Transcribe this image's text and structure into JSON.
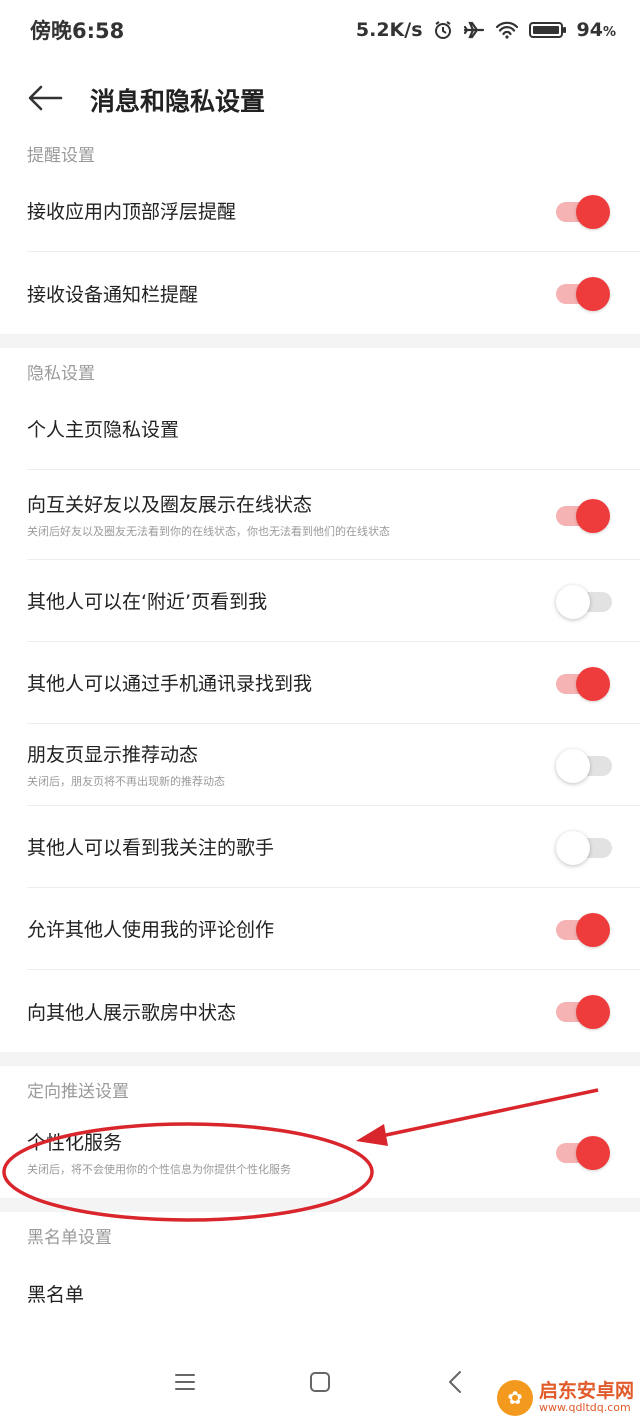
{
  "status_bar": {
    "time": "傍晚6:58",
    "network_speed": "5.2K/s",
    "battery": "94",
    "battery_unit": "%"
  },
  "header": {
    "title": "消息和隐私设置"
  },
  "sections": {
    "reminder": {
      "title": "提醒设置",
      "items": [
        {
          "label": "接收应用内顶部浮层提醒",
          "on": true
        },
        {
          "label": "接收设备通知栏提醒",
          "on": true
        }
      ]
    },
    "privacy": {
      "title": "隐私设置",
      "items": [
        {
          "label": "个人主页隐私设置"
        },
        {
          "label": "向互关好友以及圈友展示在线状态",
          "desc": "关闭后好友以及圈友无法看到你的在线状态，你也无法看到他们的在线状态",
          "on": true
        },
        {
          "label": "其他人可以在‘附近’页看到我",
          "on": false
        },
        {
          "label": "其他人可以通过手机通讯录找到我",
          "on": true
        },
        {
          "label": "朋友页显示推荐动态",
          "desc": "关闭后，朋友页将不再出现新的推荐动态",
          "on": false
        },
        {
          "label": "其他人可以看到我关注的歌手",
          "on": false
        },
        {
          "label": "允许其他人使用我的评论创作",
          "on": true
        },
        {
          "label": "向其他人展示歌房中状态",
          "on": true
        }
      ]
    },
    "targeted_push": {
      "title": "定向推送设置",
      "items": [
        {
          "label": "个性化服务",
          "desc": "关闭后，将不会使用你的个性信息为你提供个性化服务",
          "on": true
        }
      ]
    },
    "blacklist": {
      "title": "黑名单设置",
      "items": [
        {
          "label": "黑名单"
        }
      ]
    }
  },
  "watermark": {
    "name": "启东安卓网",
    "url": "www.qdltdq.com"
  },
  "colors": {
    "accent": "#ee3b3b",
    "annotation": "#d9262c"
  },
  "icons": {
    "back": "arrow-left-icon",
    "alarm": "alarm-icon",
    "airplane": "airplane-icon",
    "wifi": "wifi-icon",
    "battery": "battery-icon",
    "nav_menu": "menu-icon",
    "nav_home": "square-icon",
    "nav_back": "chevron-left-icon"
  }
}
